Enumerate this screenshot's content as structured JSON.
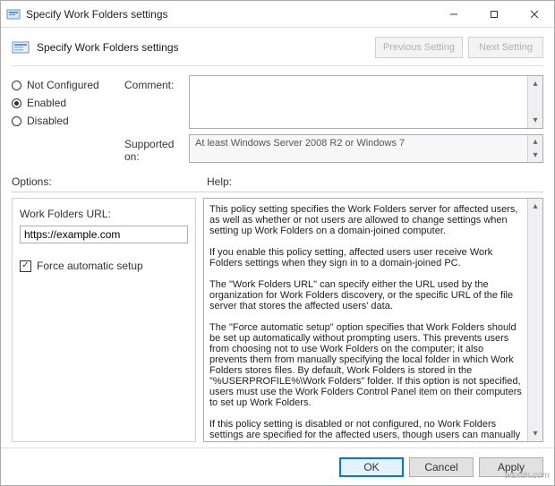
{
  "window": {
    "title": "Specify Work Folders settings"
  },
  "header": {
    "title": "Specify Work Folders settings",
    "prev": "Previous Setting",
    "next": "Next Setting"
  },
  "state_radios": {
    "not_configured": "Not Configured",
    "enabled": "Enabled",
    "disabled": "Disabled",
    "selected": "enabled"
  },
  "comment": {
    "label": "Comment:",
    "value": ""
  },
  "supported": {
    "label": "Supported on:",
    "value": "At least Windows Server 2008 R2 or Windows 7"
  },
  "labels": {
    "options": "Options:",
    "help": "Help:"
  },
  "options": {
    "url_label": "Work Folders URL:",
    "url_value": "https://example.com",
    "force_label": "Force automatic setup",
    "force_checked": true
  },
  "help_text": "This policy setting specifies the Work Folders server for affected users, as well as whether or not users are allowed to change settings when setting up Work Folders on a domain-joined computer.\n\nIf you enable this policy setting, affected users user receive Work Folders settings when they sign in to a domain-joined PC.\n\nThe \"Work Folders URL\" can specify either the URL used by the organization for Work Folders discovery, or the specific URL of the file server that stores the affected users' data.\n\nThe \"Force automatic setup\" option specifies that Work Folders should be set up automatically without prompting users. This prevents users from choosing not to use Work Folders on the computer; it also prevents them from manually specifying the local folder in which Work Folders stores files. By default, Work Folders is stored in the \"%USERPROFILE%\\Work Folders\" folder. If this option is not specified, users must use the Work Folders Control Panel item on their computers to set up Work Folders.\n\nIf this policy setting is disabled or not configured, no Work Folders settings are specified for the affected users, though users can manually set up Work Folders by",
  "footer": {
    "ok": "OK",
    "cancel": "Cancel",
    "apply": "Apply"
  },
  "watermark": "wsxdn.com"
}
